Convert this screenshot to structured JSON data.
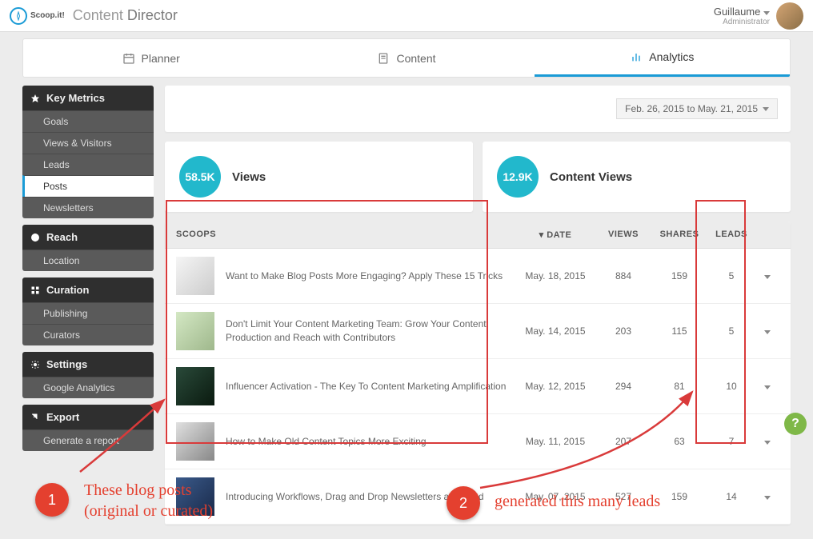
{
  "header": {
    "brand_small": "Scoop.it!",
    "brand_main": "Content",
    "brand_sub": "Director",
    "user_name": "Guillaume",
    "user_role": "Administrator"
  },
  "tabs": {
    "planner": "Planner",
    "content": "Content",
    "analytics": "Analytics"
  },
  "sidebar": {
    "key_metrics": {
      "title": "Key Metrics",
      "items": [
        "Goals",
        "Views & Visitors",
        "Leads",
        "Posts",
        "Newsletters"
      ]
    },
    "reach": {
      "title": "Reach",
      "items": [
        "Location"
      ]
    },
    "curation": {
      "title": "Curation",
      "items": [
        "Publishing",
        "Curators"
      ]
    },
    "settings": {
      "title": "Settings",
      "items": [
        "Google Analytics"
      ]
    },
    "export": {
      "title": "Export",
      "items": [
        "Generate a report"
      ]
    }
  },
  "date_range": "Feb. 26, 2015 to May. 21, 2015",
  "stats": {
    "views_value": "58.5K",
    "views_label": "Views",
    "content_value": "12.9K",
    "content_label": "Content Views"
  },
  "table": {
    "columns": {
      "scoops": "SCOOPS",
      "date": "DATE",
      "views": "VIEWS",
      "shares": "SHARES",
      "leads": "LEADS"
    },
    "rows": [
      {
        "title": "Want to Make Blog Posts More Engaging? Apply These 15 Tricks",
        "date": "May. 18, 2015",
        "views": "884",
        "shares": "159",
        "leads": "5"
      },
      {
        "title": "Don't Limit Your Content Marketing Team: Grow Your Content Production and Reach with Contributors",
        "date": "May. 14, 2015",
        "views": "203",
        "shares": "115",
        "leads": "5"
      },
      {
        "title": "Influencer Activation - The Key To Content Marketing Amplification",
        "date": "May. 12, 2015",
        "views": "294",
        "shares": "81",
        "leads": "10"
      },
      {
        "title": "How to Make Old Content Topics More Exciting",
        "date": "May. 11, 2015",
        "views": "207",
        "shares": "63",
        "leads": "7"
      },
      {
        "title": "Introducing Workflows, Drag and Drop Newsletters and Lead",
        "date": "May. 07, 2015",
        "views": "527",
        "shares": "159",
        "leads": "14"
      }
    ]
  },
  "annotations": {
    "badge1": "1",
    "badge2": "2",
    "text1": "These blog posts\n(original or curated)",
    "text2": "generated this many leads"
  },
  "help": "?"
}
